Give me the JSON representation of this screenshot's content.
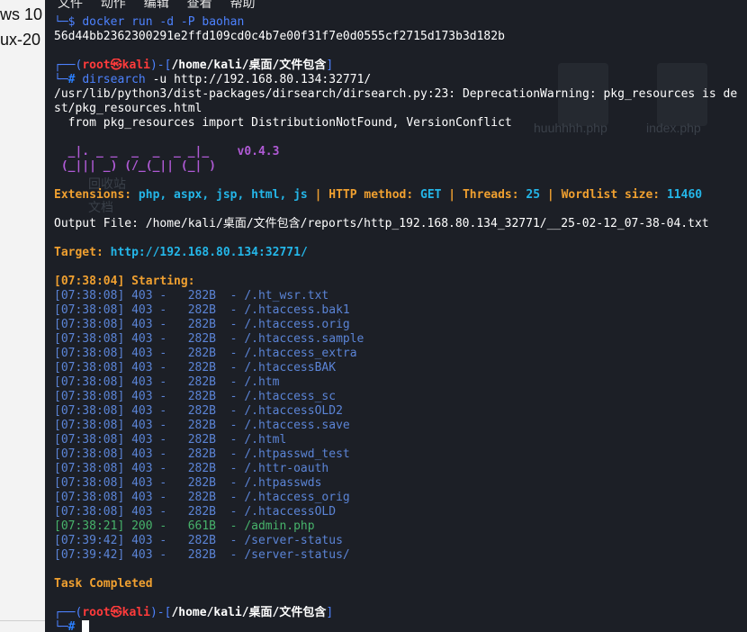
{
  "desktop_labels": [
    "ws 10",
    "ux-20"
  ],
  "menubar": [
    "文件",
    "动作",
    "编辑",
    "查看",
    "帮助"
  ],
  "terminal": {
    "top_prompt_tail": "└─",
    "docker_cmd": "docker run -d -P baohan",
    "container_id": "56d44bb2362300291e2ffd109cd0c4b7e00f31f7e0d0555cf2715d173b3d182b",
    "user": "root",
    "host": "kali",
    "cwd": "/home/kali/桌面/文件包含",
    "dirsearch_cmd": "dirsearch",
    "dirsearch_args": " -u http://192.168.80.134:32771/",
    "warn_line1": "/usr/lib/python3/dist-packages/dirsearch/dirsearch.py:23: DeprecationWarning: pkg_resources is de",
    "warn_line2": "st/pkg_resources.html",
    "warn_line3": "  from pkg_resources import DistributionNotFound, VersionConflict",
    "logo_line1": "  _|. _ _  _  _  _ _|_    v0.4.3",
    "logo_line2": " (_||| _) (/_(_|| (_| )",
    "config": {
      "ext_label": "Extensions:",
      "ext_value": "php, aspx, jsp, html, js",
      "method_label": "HTTP method:",
      "method_value": "GET",
      "threads_label": "Threads:",
      "threads_value": "25",
      "wordlist_label": "Wordlist size:",
      "wordlist_value": "11460",
      "sep": " | "
    },
    "output_file": "Output File: /home/kali/桌面/文件包含/reports/http_192.168.80.134_32771/__25-02-12_07-38-04.txt",
    "target_label": "Target:",
    "target_value": "http://192.168.80.134:32771/",
    "starting": "[07:38:04] Starting:",
    "results": [
      {
        "line": "[07:38:08] 403 -   282B  - /.ht_wsr.txt",
        "status": "403"
      },
      {
        "line": "[07:38:08] 403 -   282B  - /.htaccess.bak1",
        "status": "403"
      },
      {
        "line": "[07:38:08] 403 -   282B  - /.htaccess.orig",
        "status": "403"
      },
      {
        "line": "[07:38:08] 403 -   282B  - /.htaccess.sample",
        "status": "403"
      },
      {
        "line": "[07:38:08] 403 -   282B  - /.htaccess_extra",
        "status": "403"
      },
      {
        "line": "[07:38:08] 403 -   282B  - /.htaccessBAK",
        "status": "403"
      },
      {
        "line": "[07:38:08] 403 -   282B  - /.htm",
        "status": "403"
      },
      {
        "line": "[07:38:08] 403 -   282B  - /.htaccess_sc",
        "status": "403"
      },
      {
        "line": "[07:38:08] 403 -   282B  - /.htaccessOLD2",
        "status": "403"
      },
      {
        "line": "[07:38:08] 403 -   282B  - /.htaccess.save",
        "status": "403"
      },
      {
        "line": "[07:38:08] 403 -   282B  - /.html",
        "status": "403"
      },
      {
        "line": "[07:38:08] 403 -   282B  - /.htpasswd_test",
        "status": "403"
      },
      {
        "line": "[07:38:08] 403 -   282B  - /.httr-oauth",
        "status": "403"
      },
      {
        "line": "[07:38:08] 403 -   282B  - /.htpasswds",
        "status": "403"
      },
      {
        "line": "[07:38:08] 403 -   282B  - /.htaccess_orig",
        "status": "403"
      },
      {
        "line": "[07:38:08] 403 -   282B  - /.htaccessOLD",
        "status": "403"
      },
      {
        "line": "[07:38:21] 200 -   661B  - /admin.php",
        "status": "200"
      },
      {
        "line": "[07:39:42] 403 -   282B  - /server-status",
        "status": "403"
      },
      {
        "line": "[07:39:42] 403 -   282B  - /server-status/",
        "status": "403"
      }
    ],
    "task_completed": "Task Completed"
  },
  "ghost_bg": [
    "huuhhhh.php",
    "index.php",
    "回收站",
    "文档"
  ],
  "colors": {
    "terminal_bg": "#1c1f26",
    "prompt_blue": "#4d82ff",
    "root_red": "#ff3b3b",
    "orange": "#f0a030",
    "cyan": "#24b6e8",
    "status_403": "#5b84d6",
    "status_200": "#47b36b"
  }
}
